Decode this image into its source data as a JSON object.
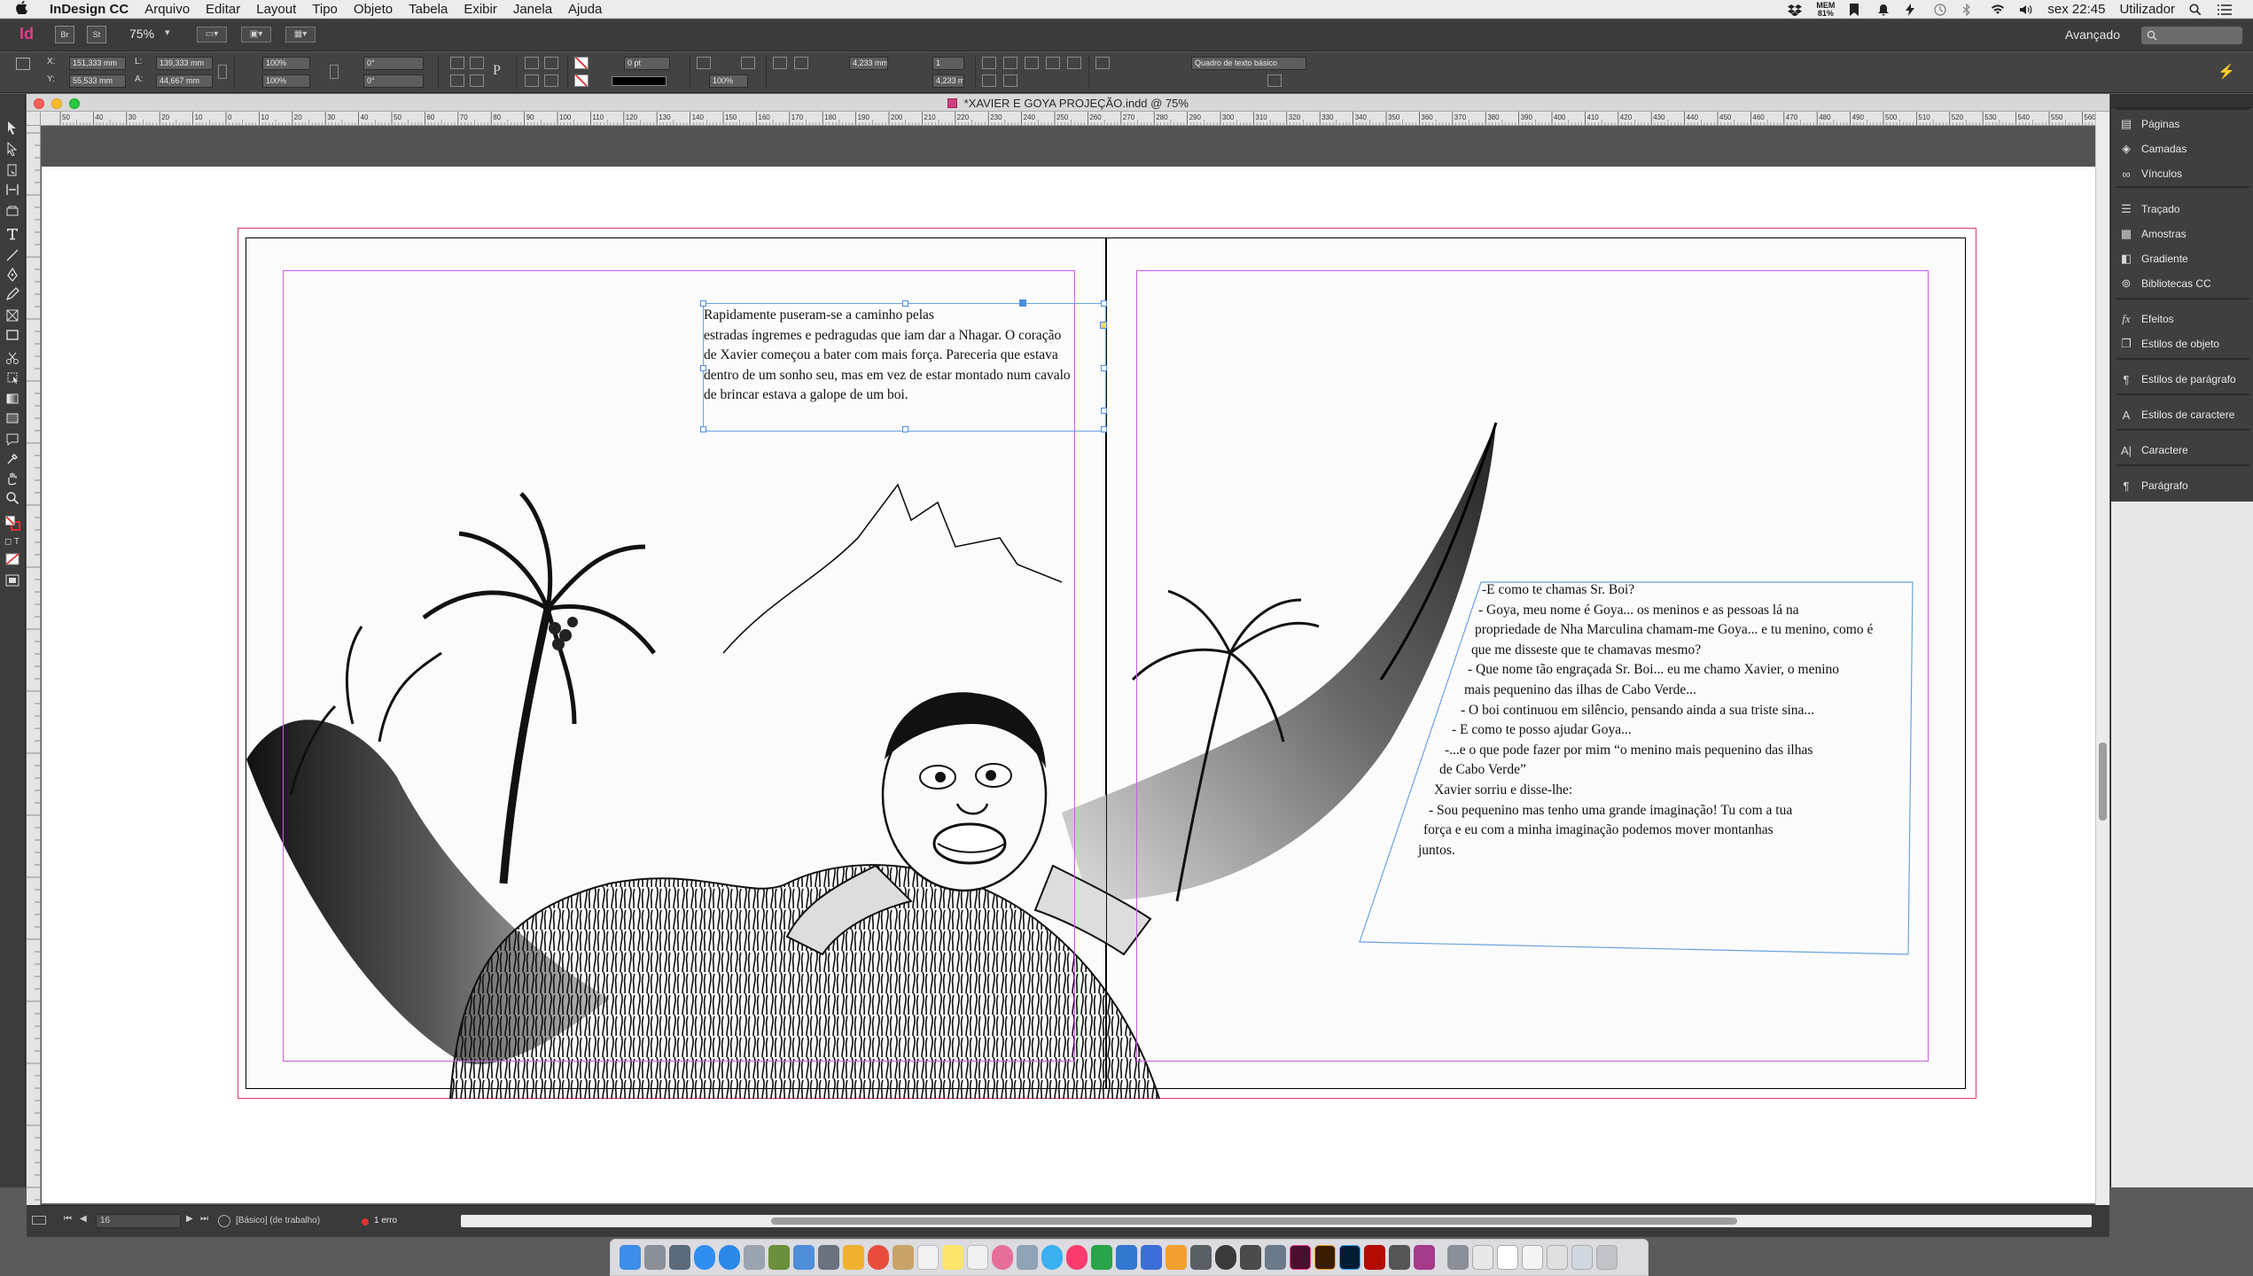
{
  "menubar": {
    "app_name": "InDesign CC",
    "menus": [
      "Arquivo",
      "Editar",
      "Layout",
      "Tipo",
      "Objeto",
      "Tabela",
      "Exibir",
      "Janela",
      "Ajuda"
    ],
    "status": {
      "mem_label": "MEM",
      "mem_value": "81%",
      "clock": "sex 22:45",
      "user": "Utilizador"
    }
  },
  "appbar": {
    "logo": "Id",
    "bridge": "Br",
    "stock": "St",
    "zoom": "75%",
    "workspace": "Avançado"
  },
  "control": {
    "x_label": "X:",
    "x_value": "151,333 mm",
    "y_label": "Y:",
    "y_value": "55,533 mm",
    "w_label": "L:",
    "w_value": "139,333 mm",
    "h_label": "A:",
    "h_value": "44,667 mm",
    "scale_x": "100%",
    "scale_y": "100%",
    "rotate": "0°",
    "shear": "0°",
    "stroke_weight": "0 pt",
    "opacity": "100%",
    "gutter": "4,233 mm",
    "gutter2": "4,233 mm",
    "columns": "1",
    "style_dropdown": "Quadro de texto básico"
  },
  "document": {
    "title": "*XAVIER E GOYA PROJEÇÃO.indd @ 75%",
    "ruler_ticks": [
      "50",
      "40",
      "30",
      "20",
      "10",
      "0",
      "10",
      "20",
      "30",
      "40",
      "50",
      "60",
      "70",
      "80",
      "90",
      "100",
      "110",
      "120",
      "130",
      "140",
      "150",
      "160",
      "170",
      "180",
      "190",
      "200",
      "210",
      "220",
      "230",
      "240",
      "250",
      "260",
      "270",
      "280",
      "290",
      "300",
      "310",
      "320",
      "330",
      "340",
      "350",
      "360",
      "370",
      "380",
      "390",
      "400",
      "410",
      "420",
      "430",
      "440",
      "450",
      "460",
      "470",
      "480",
      "490",
      "500",
      "510",
      "520",
      "530",
      "540",
      "550",
      "560"
    ]
  },
  "story": {
    "left_lines": [
      "Rapidamente puseram-se a caminho pelas",
      "estradas íngremes e pedragudas que iam dar a Nhagar. O coração",
      "de Xavier começou a bater com mais força. Pareceria que estava",
      "dentro de um sonho seu, mas em vez de estar montado num cavalo",
      "de brincar estava a galope de um boi."
    ],
    "right_lines": [
      "-E como te chamas Sr. Boi?",
      "- Goya, meu nome é Goya... os meninos e as pessoas lá na",
      "propriedade de Nha Marculina chamam-me Goya... e tu menino, como é",
      "que me disseste que te chamavas mesmo?",
      "- Que nome tão engraçada Sr. Boi... eu me chamo Xavier, o menino",
      "mais pequenino das ilhas de Cabo Verde...",
      "- O boi continuou em silêncio, pensando ainda a sua triste sina...",
      "- E como te posso ajudar Goya...",
      "-...e o que pode fazer por mim “o menino mais pequenino das ilhas",
      "de Cabo Verde”",
      "Xavier sorriu e disse-lhe:",
      "- Sou pequenino mas tenho uma grande imaginação! Tu com a tua",
      "força e eu com a minha imaginação podemos mover montanhas",
      "juntos."
    ]
  },
  "panels": [
    {
      "label": "Páginas",
      "icon": "pages-icon"
    },
    {
      "label": "Camadas",
      "icon": "layers-icon"
    },
    {
      "label": "Vínculos",
      "icon": "links-icon"
    },
    {
      "label": "Traçado",
      "icon": "stroke-icon"
    },
    {
      "label": "Amostras",
      "icon": "swatches-icon"
    },
    {
      "label": "Gradiente",
      "icon": "gradient-icon"
    },
    {
      "label": "Bibliotecas CC",
      "icon": "cc-libraries-icon"
    },
    {
      "label": "Efeitos",
      "icon": "effects-icon"
    },
    {
      "label": "Estilos de objeto",
      "icon": "object-styles-icon"
    },
    {
      "label": "Estilos de parágrafo",
      "icon": "paragraph-styles-icon"
    },
    {
      "label": "Estilos de caractere",
      "icon": "character-styles-icon"
    },
    {
      "label": "Caractere",
      "icon": "character-icon"
    },
    {
      "label": "Parágrafo",
      "icon": "paragraph-icon"
    }
  ],
  "status": {
    "page": "16",
    "preflight_profile": "[Básico] (de trabalho)",
    "errors": "1 erro"
  },
  "colors": {
    "accent": "#e63c8c",
    "bleed": "#e03a6a",
    "margin": "#c95ce6",
    "frame": "#6aa3e0",
    "error": "#e03030"
  }
}
